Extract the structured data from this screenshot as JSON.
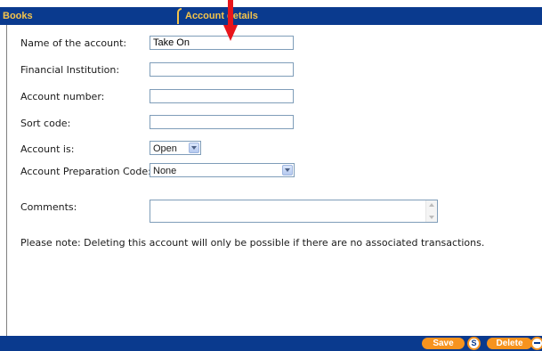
{
  "tabs": {
    "books": "Books",
    "account_details": "Account details"
  },
  "form": {
    "name_label": "Name of the account:",
    "name_value": "Take On",
    "institution_label": "Financial Institution:",
    "institution_value": "",
    "account_number_label": "Account number:",
    "account_number_value": "",
    "sort_code_label": "Sort code:",
    "sort_code_value": "",
    "status_label": "Account is:",
    "status_value": "Open",
    "prep_code_label": "Account Preparation Code:",
    "prep_code_value": "None",
    "comments_label": "Comments:",
    "comments_value": ""
  },
  "note": "Please note: Deleting this account will only be possible if there are no associated transactions.",
  "buttons": {
    "save": "Save",
    "save_key": "S",
    "delete": "Delete"
  },
  "colors": {
    "bar": "#0a3a8e",
    "tab_text": "#f6c44a",
    "button": "#f7931e",
    "annotation_arrow": "#e8151b"
  },
  "icons": {
    "annotation": "red-down-arrow",
    "select": "chevron-down-icon"
  }
}
